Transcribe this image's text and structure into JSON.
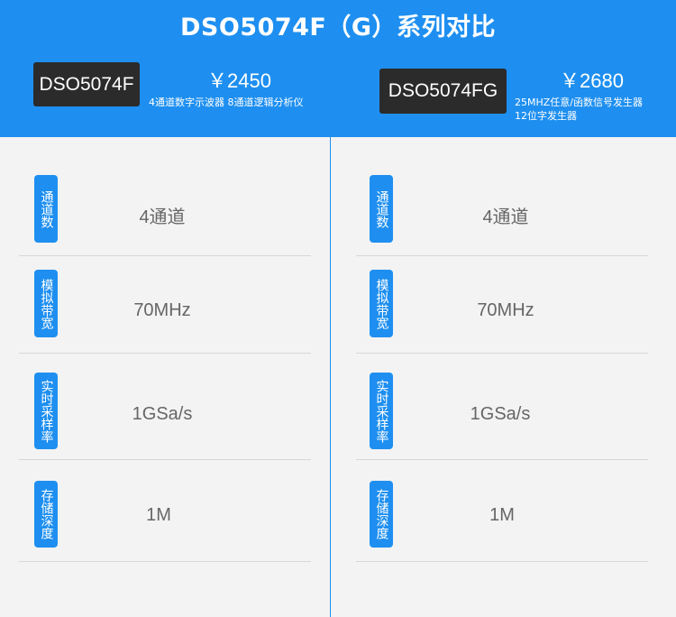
{
  "title": "DSO5074F（G）系列对比",
  "colors": {
    "accent": "#1e8ff0",
    "model_bg": "#2b2b2b",
    "page_bg": "#f3f3f3"
  },
  "left": {
    "model": "DSO5074F",
    "price": "￥2450",
    "desc": "4通道数字示波器 8通道逻辑分析仪",
    "specs": [
      {
        "label": "通道数",
        "value": "4通道"
      },
      {
        "label": "模拟带宽",
        "value": "70MHz"
      },
      {
        "label": "实时采样率",
        "value": "1GSa/s"
      },
      {
        "label": "存储深度",
        "value": "1M"
      }
    ]
  },
  "right": {
    "model": "DSO5074FG",
    "price": "￥2680",
    "desc_line1": "25MHZ任意/函数信号发生器",
    "desc_line2": "12位字发生器",
    "specs": [
      {
        "label": "通道数",
        "value": "4通道"
      },
      {
        "label": "模拟带宽",
        "value": "70MHz"
      },
      {
        "label": "实时采样率",
        "value": "1GSa/s"
      },
      {
        "label": "存储深度",
        "value": "1M"
      }
    ]
  }
}
